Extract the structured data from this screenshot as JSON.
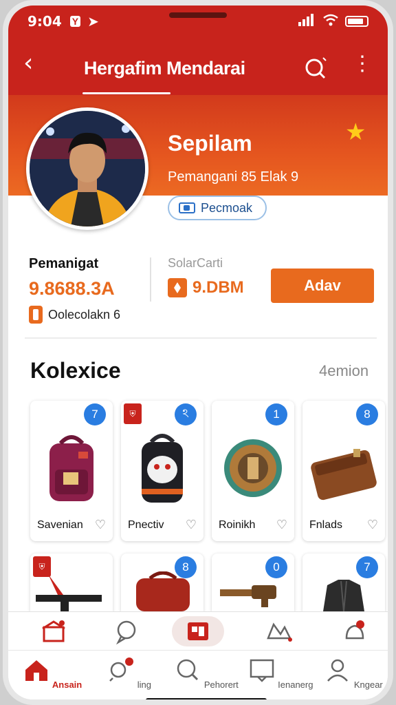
{
  "status_bar": {
    "time": "9:04",
    "sim_label": "Y"
  },
  "header": {
    "title": "Hergafim Mendarai"
  },
  "profile": {
    "name": "Sepilam",
    "subtitle": "Pemangani 85 Elak 9",
    "promo_label": "Pecmoak"
  },
  "stats": {
    "left_label": "Pemanigat",
    "left_value": "9.8688.3A",
    "left_foot": "Oolecolakn 6",
    "mid_label": "SolarCarti",
    "mid_value": "9.DBM",
    "action_label": "Adav"
  },
  "section": {
    "title": "Kolexice",
    "count": "4emion"
  },
  "cards": [
    {
      "label": "Savenian",
      "badge": "7"
    },
    {
      "label": "Pnectiv",
      "badge": "ঽ"
    },
    {
      "label": "Roinikh",
      "badge": "1"
    },
    {
      "label": "Fnlads",
      "badge": "8"
    },
    {
      "label": "",
      "badge": ""
    },
    {
      "label": "",
      "badge": "8"
    },
    {
      "label": "",
      "badge": "0"
    },
    {
      "label": "",
      "badge": "7"
    }
  ],
  "bottom_nav": [
    {
      "label": "Ansain"
    },
    {
      "label": "ling"
    },
    {
      "label": "Pehorert"
    },
    {
      "label": "Ienanerg"
    },
    {
      "label": "Kngear"
    }
  ],
  "colors": {
    "brand_red": "#c8231c",
    "accent_orange": "#e86a1e",
    "badge_blue": "#2a7de1",
    "star_yellow": "#ffcc1a"
  },
  "icons": [
    "back-arrow-icon",
    "search-icon",
    "more-icon",
    "star-icon",
    "home-icon",
    "chat-icon",
    "search-icon",
    "map-icon",
    "user-icon"
  ]
}
